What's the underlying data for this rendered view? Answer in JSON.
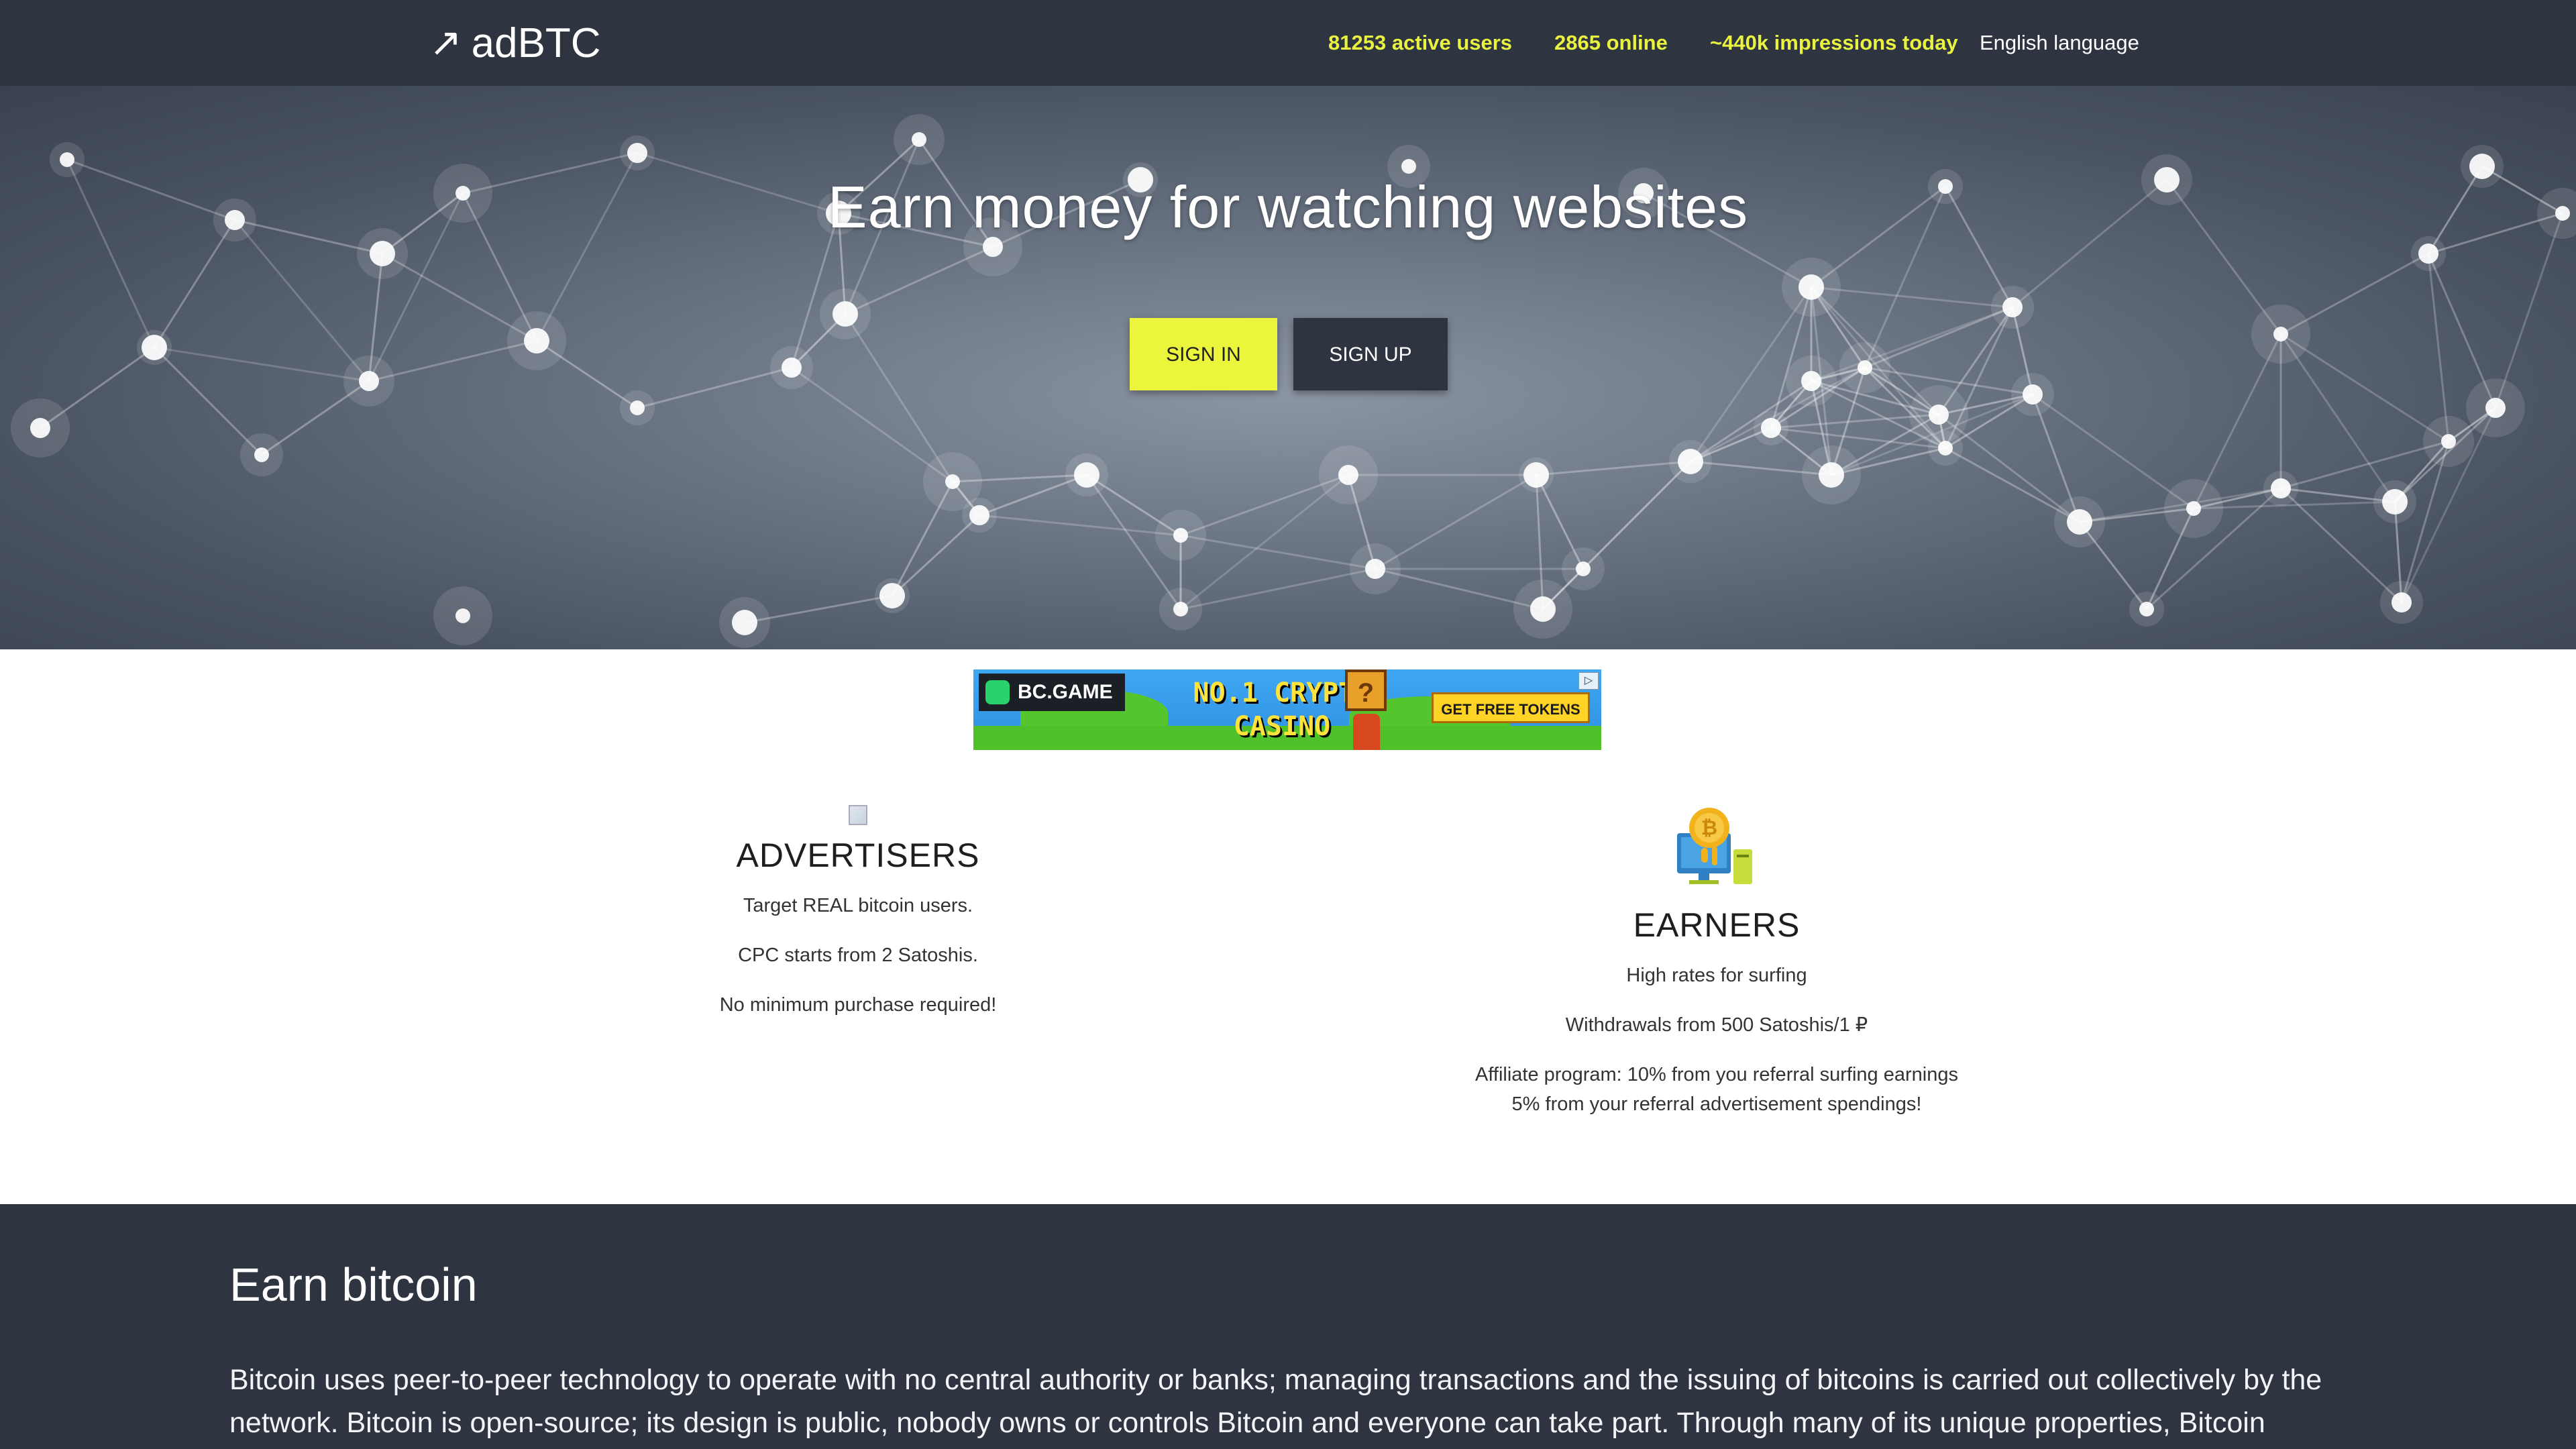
{
  "navbar": {
    "brand_icon": "↗",
    "brand": "adBTC",
    "active_users": "81253 active users",
    "online": "2865 online",
    "impressions": "~440k impressions today",
    "language": "English language",
    "stat_color": "#e8f23f"
  },
  "hero": {
    "title": "Earn money for watching websites",
    "sign_in": "SIGN IN",
    "sign_up": "SIGN UP",
    "sign_in_color": "#eaf53b",
    "sign_up_color": "#2e3440"
  },
  "ad": {
    "brand": "BC.GAME",
    "headline_1": "NO.1 CRYPTO",
    "headline_2": "CASINO",
    "cta": "GET FREE TOKENS",
    "question": "?"
  },
  "advertisers": {
    "title": "ADVERTISERS",
    "lines": [
      "Target REAL bitcoin users.",
      "CPC starts from 2 Satoshis.",
      "No minimum purchase required!"
    ]
  },
  "earners": {
    "title": "EARNERS",
    "lines": [
      "High rates for surfing",
      "Withdrawals from 500 Satoshis/1 ₽",
      "Affiliate program: 10% from you referral surfing earnings",
      "5% from your referral advertisement spendings!"
    ]
  },
  "seo": {
    "title": "Earn bitcoin",
    "text": "Bitcoin uses peer-to-peer technology to operate with no central authority or banks; managing transactions and the issuing of bitcoins is carried out collectively by the network. Bitcoin is open-source; its design is public, nobody owns or controls Bitcoin and everyone can take part. Through many of its unique properties, Bitcoin allows"
  }
}
